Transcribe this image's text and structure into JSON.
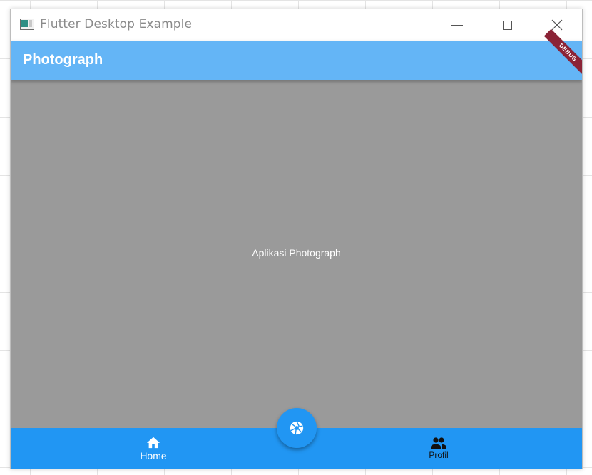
{
  "window": {
    "title": "Flutter Desktop Example"
  },
  "appbar": {
    "title": "Photograph",
    "debug_banner": "DEBUG"
  },
  "body": {
    "text": "Aplikasi Photograph"
  },
  "bottom_nav": {
    "items": [
      {
        "label": "Home",
        "icon": "home-icon",
        "active": true
      },
      {
        "label": "Profil",
        "icon": "people-icon",
        "active": false
      }
    ]
  },
  "fab": {
    "icon": "camera-icon"
  },
  "colors": {
    "appbar": "#64b5f6",
    "body": "#9a9a9a",
    "bottom_nav": "#2196f3",
    "fab": "#2196f3",
    "debug_ribbon": "#8b2336"
  }
}
